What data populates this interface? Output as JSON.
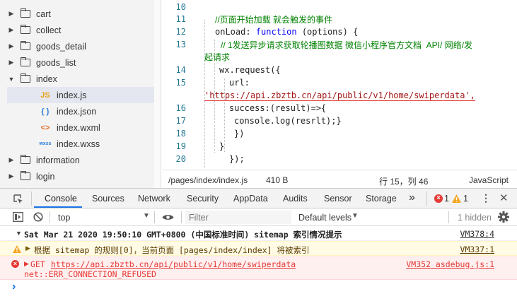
{
  "tree": {
    "items": [
      {
        "label": "cart",
        "type": "folder",
        "open": false
      },
      {
        "label": "collect",
        "type": "folder",
        "open": false
      },
      {
        "label": "goods_detail",
        "type": "folder",
        "open": false
      },
      {
        "label": "goods_list",
        "type": "folder",
        "open": false
      },
      {
        "label": "index",
        "type": "folder",
        "open": true
      },
      {
        "label": "index.js",
        "type": "js",
        "icon": "JS",
        "selected": true
      },
      {
        "label": "index.json",
        "type": "json",
        "icon": "{ }"
      },
      {
        "label": "index.wxml",
        "type": "wxml",
        "icon": "<>"
      },
      {
        "label": "index.wxss",
        "type": "wxss",
        "icon": "wxss"
      },
      {
        "label": "information",
        "type": "folder",
        "open": false
      },
      {
        "label": "login",
        "type": "folder",
        "open": false
      }
    ]
  },
  "editor": {
    "lines": [
      {
        "n": "10",
        "text": ""
      },
      {
        "n": "11",
        "text": "//页面开始加载 就会触发的事件"
      },
      {
        "n": "12",
        "kw1": "onLoad: ",
        "kw2": "function",
        "rest": " (options) {"
      },
      {
        "n": "13",
        "text": "// 1发送异步请求获取轮播图数据 微信小程序官方文档  API/ 网络/发",
        "cont": "起请求"
      },
      {
        "n": "14",
        "text": "wx.request({"
      },
      {
        "n": "15",
        "text": "url:",
        "cont": "'https://api.zbztb.cn/api/public/v1/home/swiperdata',"
      },
      {
        "n": "16",
        "text": "success:(result)=>{"
      },
      {
        "n": "17",
        "text": "console.log(resrlt);}"
      },
      {
        "n": "18",
        "text": "})"
      },
      {
        "n": "19",
        "text": "}"
      },
      {
        "n": "20",
        "text": "});"
      }
    ]
  },
  "status": {
    "path": "/pages/index/index.js",
    "size": "410 B",
    "position": "行 15，列 46",
    "language": "JavaScript"
  },
  "devtools": {
    "tabs": [
      "Console",
      "Sources",
      "Network",
      "Security",
      "AppData",
      "Audits",
      "Sensor",
      "Storage"
    ],
    "more": "»",
    "error_count": "1",
    "warning_count": "1",
    "context": "top",
    "filter_placeholder": "Filter",
    "levels": "Default levels",
    "hidden": "1 hidden"
  },
  "console": {
    "messages": [
      {
        "level": "info",
        "text": "Sat Mar 21 2020 19:50:10 GMT+0800 (中国标准时间) sitemap 索引情况提示",
        "source": "VM378:4"
      },
      {
        "level": "warning",
        "text": "根据 sitemap 的规则[0]，当前页面 [pages/index/index] 将被索引",
        "source": "VM337:1"
      },
      {
        "level": "error",
        "method": "GET",
        "url": "https://api.zbztb.cn/api/public/v1/home/swiperdata",
        "text2": "net::ERR_CONNECTION_REFUSED",
        "source": "VM352 asdebug.js:1"
      }
    ],
    "prompt": "›"
  },
  "colors": {
    "accent": "#1a73e8",
    "error": "#e53935",
    "warning": "#f5a623",
    "comment": "#008000",
    "keyword": "#0000ff",
    "string": "#a31515"
  }
}
